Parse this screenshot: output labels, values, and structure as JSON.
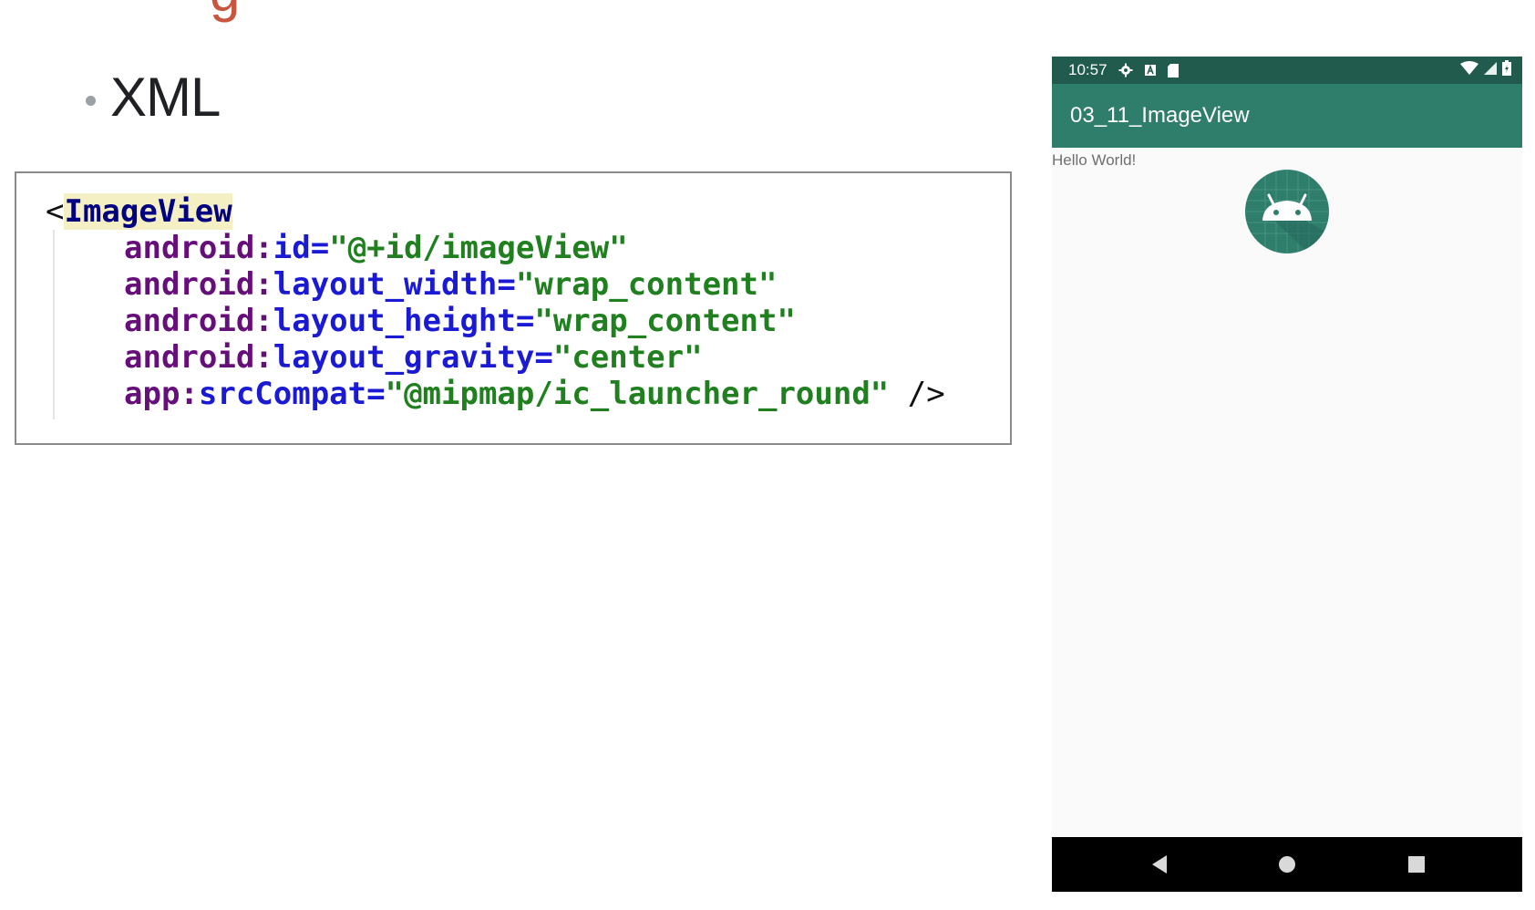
{
  "slide": {
    "bullet": "XML",
    "title_fragment": "g"
  },
  "code": {
    "line1": {
      "open": "<",
      "tag": "ImageView"
    },
    "line2": {
      "attr": "android:",
      "name": "id=",
      "value": "\"@+id/imageView\""
    },
    "line3": {
      "attr": "android:",
      "name": "layout_width=",
      "value": "\"wrap_content\""
    },
    "line4": {
      "attr": "android:",
      "name": "layout_height=",
      "value": "\"wrap_content\""
    },
    "line5": {
      "attr": "android:",
      "name": "layout_gravity=",
      "value": "\"center\""
    },
    "line6": {
      "attr": "app:",
      "name": "srcCompat=",
      "value": "\"@mipmap/ic_launcher_round\"",
      "close": " />"
    }
  },
  "phone": {
    "status": {
      "time": "10:57"
    },
    "app_title": "03_11_ImageView",
    "hello_text": "Hello World!",
    "colors": {
      "status_bar": "#215b4e",
      "app_bar": "#2f7d6b",
      "launcher_bg": "#2f7d6b"
    }
  }
}
